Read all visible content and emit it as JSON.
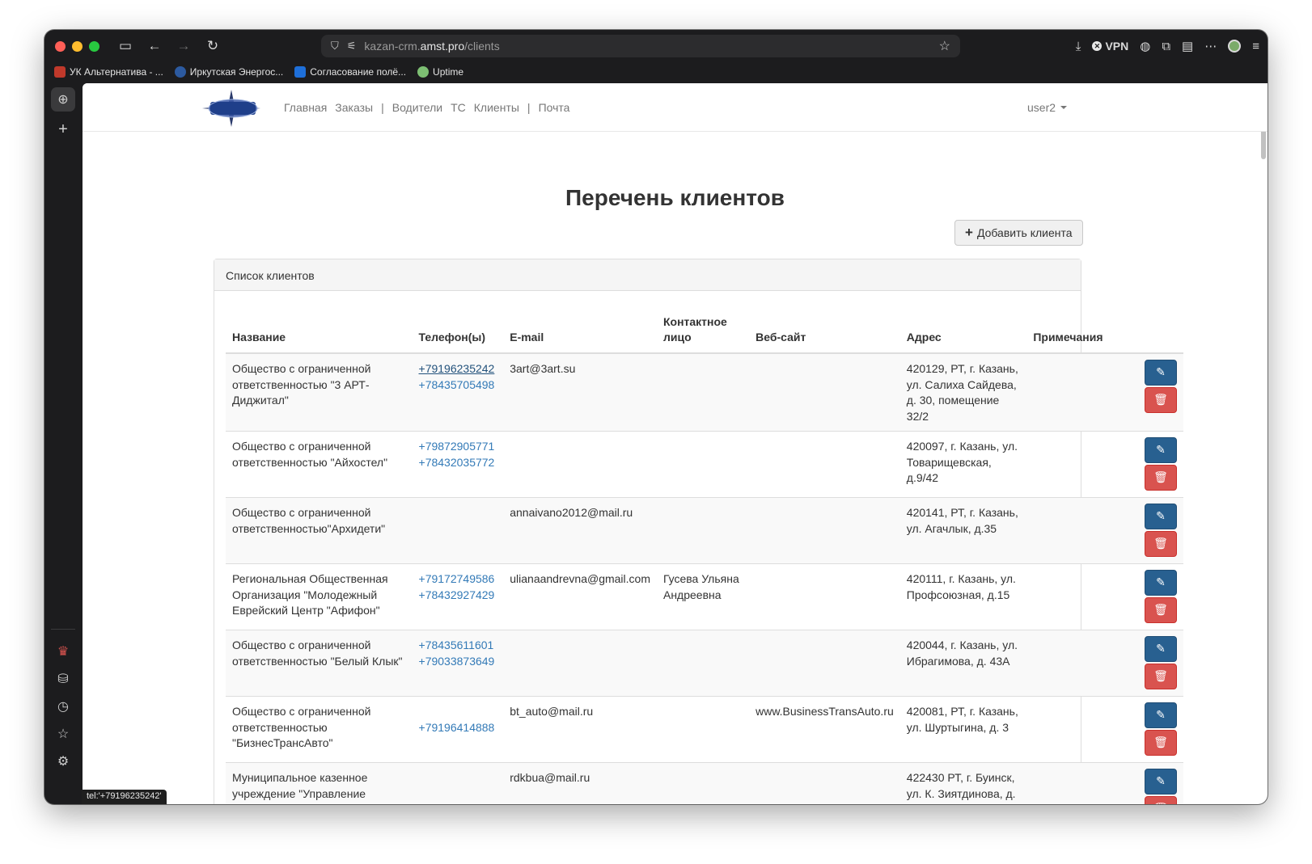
{
  "browser": {
    "url_host_prefix": "kazan-crm.",
    "url_host": "amst.pro",
    "url_path": "/clients",
    "vpn_label": "VPN",
    "status_url": "tel:'+79196235242'",
    "bookmarks": [
      {
        "label": "УК Альтернатива - ...",
        "color": "#c0392b"
      },
      {
        "label": "Иркутская Энергос...",
        "color": "#2c5aa0"
      },
      {
        "label": "Согласование полё...",
        "color": "#1e6fd9"
      },
      {
        "label": "Uptime",
        "color": "#7dbf73"
      }
    ]
  },
  "site": {
    "nav": [
      {
        "label": "Главная"
      },
      {
        "label": "Заказы"
      },
      {
        "sep": "|"
      },
      {
        "label": "Водители"
      },
      {
        "label": "ТС"
      },
      {
        "label": "Клиенты"
      },
      {
        "sep": "|"
      },
      {
        "label": "Почта"
      }
    ],
    "user": "user2",
    "page_title": "Перечень клиентов",
    "add_button": "Добавить клиента",
    "panel_title": "Список клиентов"
  },
  "table": {
    "headers": {
      "name": "Название",
      "phone": "Телефон(ы)",
      "email": "E-mail",
      "contact_line1": "Контактное",
      "contact_line2": "лицо",
      "website": "Веб-сайт",
      "address": "Адрес",
      "notes": "Примечания"
    },
    "rows": [
      {
        "name": "Общество с ограниченной ответственностью \"3 АРТ-Диджитал\"",
        "phones": [
          "+79196235242",
          "+78435705498"
        ],
        "phone_hover": 0,
        "email": "3art@3art.su",
        "contact": "",
        "website": "",
        "address": "420129, РТ, г. Казань, ул. Салиха Сайдева, д. 30, помещение 32/2",
        "notes": ""
      },
      {
        "name": "Общество с ограниченной ответственностью \"Айхостел\"",
        "phones": [
          "+79872905771",
          "+78432035772"
        ],
        "email": "",
        "contact": "",
        "website": "",
        "address": "420097, г. Казань, ул. Товарищевская, д.9/42",
        "notes": ""
      },
      {
        "name": "Общество с ограниченной ответственностью\"Архидети\"",
        "phones": [],
        "email": "annaivano2012@mail.ru",
        "contact": "",
        "website": "",
        "address": "420141, РТ, г. Казань, ул. Агачлык, д.35",
        "notes": ""
      },
      {
        "name": "Региональная Общественная Организация \"Молодежный Еврейский Центр \"Афифон\"",
        "phones": [
          "+79172749586",
          "+78432927429"
        ],
        "email": "ulianaandrevna@gmail.com",
        "contact": "Гусева Ульяна Андреевна",
        "website": "",
        "address": "420111, г. Казань, ул. Профсоюзная, д.15",
        "notes": ""
      },
      {
        "name": "Общество с ограниченной ответственностью \"Белый Клык\"",
        "phones": [
          "+78435611601",
          "+79033873649"
        ],
        "email": "",
        "contact": "",
        "website": "",
        "address": "420044, г. Казань, ул. Ибрагимова, д. 43А",
        "notes": ""
      },
      {
        "name": "Общество с ограниченной ответственностью \"БизнесТрансАвто\"",
        "phones": [
          "",
          "+79196414888"
        ],
        "email": "bt_auto@mail.ru",
        "contact": "",
        "website": "www.BusinessTransAuto.ru",
        "address": "420081, РТ, г. Казань, ул. Шуртыгина, д. 3",
        "notes": ""
      },
      {
        "name": "Муниципальное казенное учреждение \"Управление",
        "phones": [],
        "email": "rdkbua@mail.ru",
        "contact": "",
        "website": "",
        "address": "422430 РТ, г. Буинск, ул. К. Зиятдинова, д.",
        "notes": ""
      }
    ]
  }
}
